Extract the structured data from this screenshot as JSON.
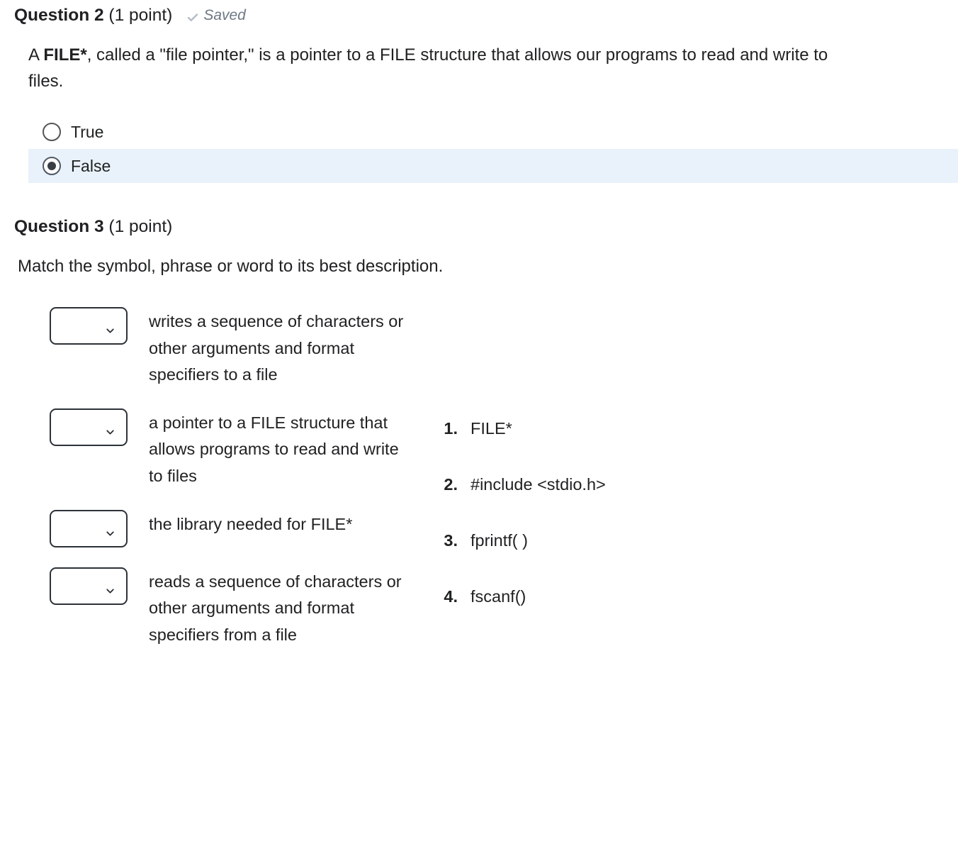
{
  "q2": {
    "label": "Question 2",
    "points": "(1 point)",
    "saved": "Saved",
    "prompt_prefix": "A ",
    "prompt_bold": "FILE*",
    "prompt_rest": ", called a \"file pointer,\" is a pointer to a FILE structure that allows our programs to read and write to files.",
    "options": {
      "true": "True",
      "false": "False"
    },
    "selected": "false"
  },
  "q3": {
    "label": "Question 3",
    "points": "(1 point)",
    "prompt": "Match the symbol, phrase or word to its best description.",
    "matches": [
      "writes a sequence of characters or other arguments and format specifiers to a file",
      "a pointer to a FILE structure that allows programs to read and write to files",
      "the library needed for FILE*",
      "reads a sequence of characters or other arguments and format specifiers from a file"
    ],
    "answers": [
      "FILE*",
      "#include <stdio.h>",
      "fprintf( )",
      "fscanf()"
    ]
  }
}
